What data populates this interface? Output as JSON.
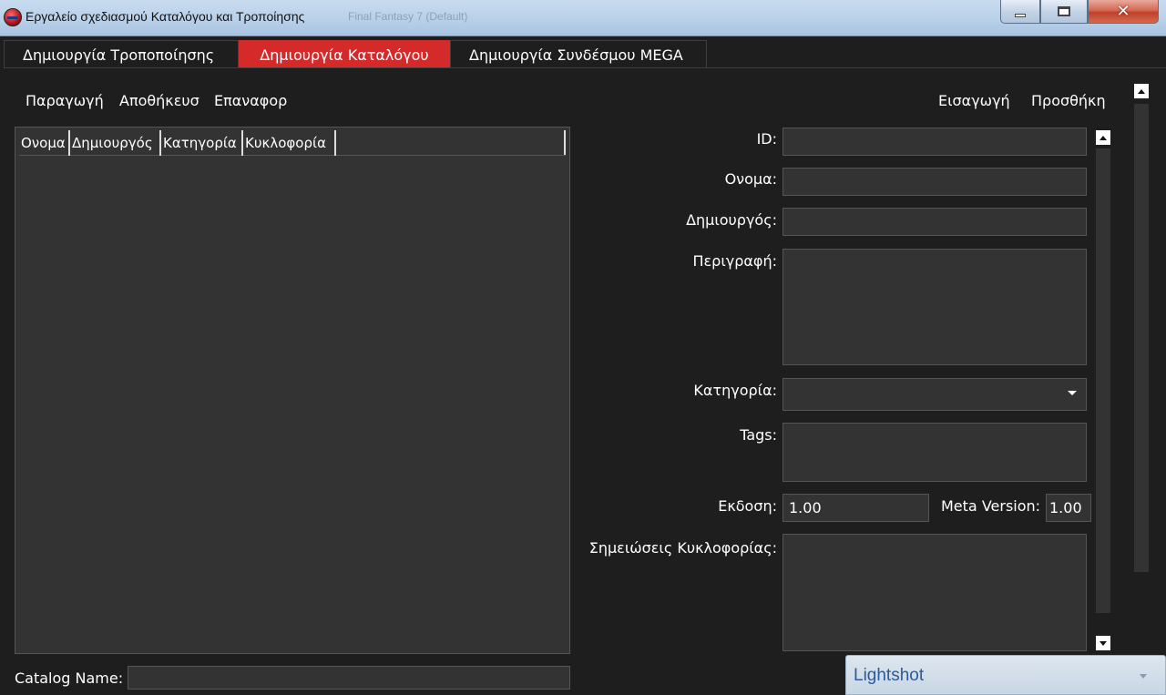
{
  "window": {
    "title": "Εργαλείο σχεδιασμού Καταλόγου και Τροποίησης",
    "faded_title": "Final Fantasy 7 (Default)",
    "close_glyph": "✕"
  },
  "tabs": [
    {
      "label": "Δημιουργία Τροποποίησης",
      "active": false
    },
    {
      "label": "Δημιουργία Καταλόγου",
      "active": true
    },
    {
      "label": "Δημιουργία Συνδέσμου MEGA",
      "active": false
    }
  ],
  "toolbar": {
    "left": [
      "Παραγωγή",
      "Αποθήκευσ",
      "Επαναφορ"
    ],
    "right": [
      "Εισαγωγή",
      "Προσθήκη"
    ]
  },
  "list": {
    "columns": [
      "Ονομα",
      "Δημιουργός",
      "Κατηγορία",
      "Κυκλοφορία"
    ]
  },
  "catalog": {
    "label": "Catalog Name:",
    "value": ""
  },
  "form": {
    "id_label": "ID:",
    "id_value": "",
    "name_label": "Ονομα:",
    "name_value": "",
    "author_label": "Δημιουργός:",
    "author_value": "",
    "description_label": "Περιγραφή:",
    "description_value": "",
    "category_label": "Κατηγορία:",
    "category_value": "",
    "tags_label": "Tags:",
    "tags_value": "",
    "version_label": "Εκδοση:",
    "version_value": "1.00",
    "meta_version_label": "Meta Version:",
    "meta_version_value": "1.00",
    "release_notes_label": "Σημειώσεις Κυκλοφορίας:",
    "release_notes_value": ""
  },
  "notification": {
    "title": "Lightshot"
  },
  "colors": {
    "background": "#1e1e1e",
    "panel": "#333333",
    "accent": "#d42a2a",
    "text": "#ffffff"
  }
}
